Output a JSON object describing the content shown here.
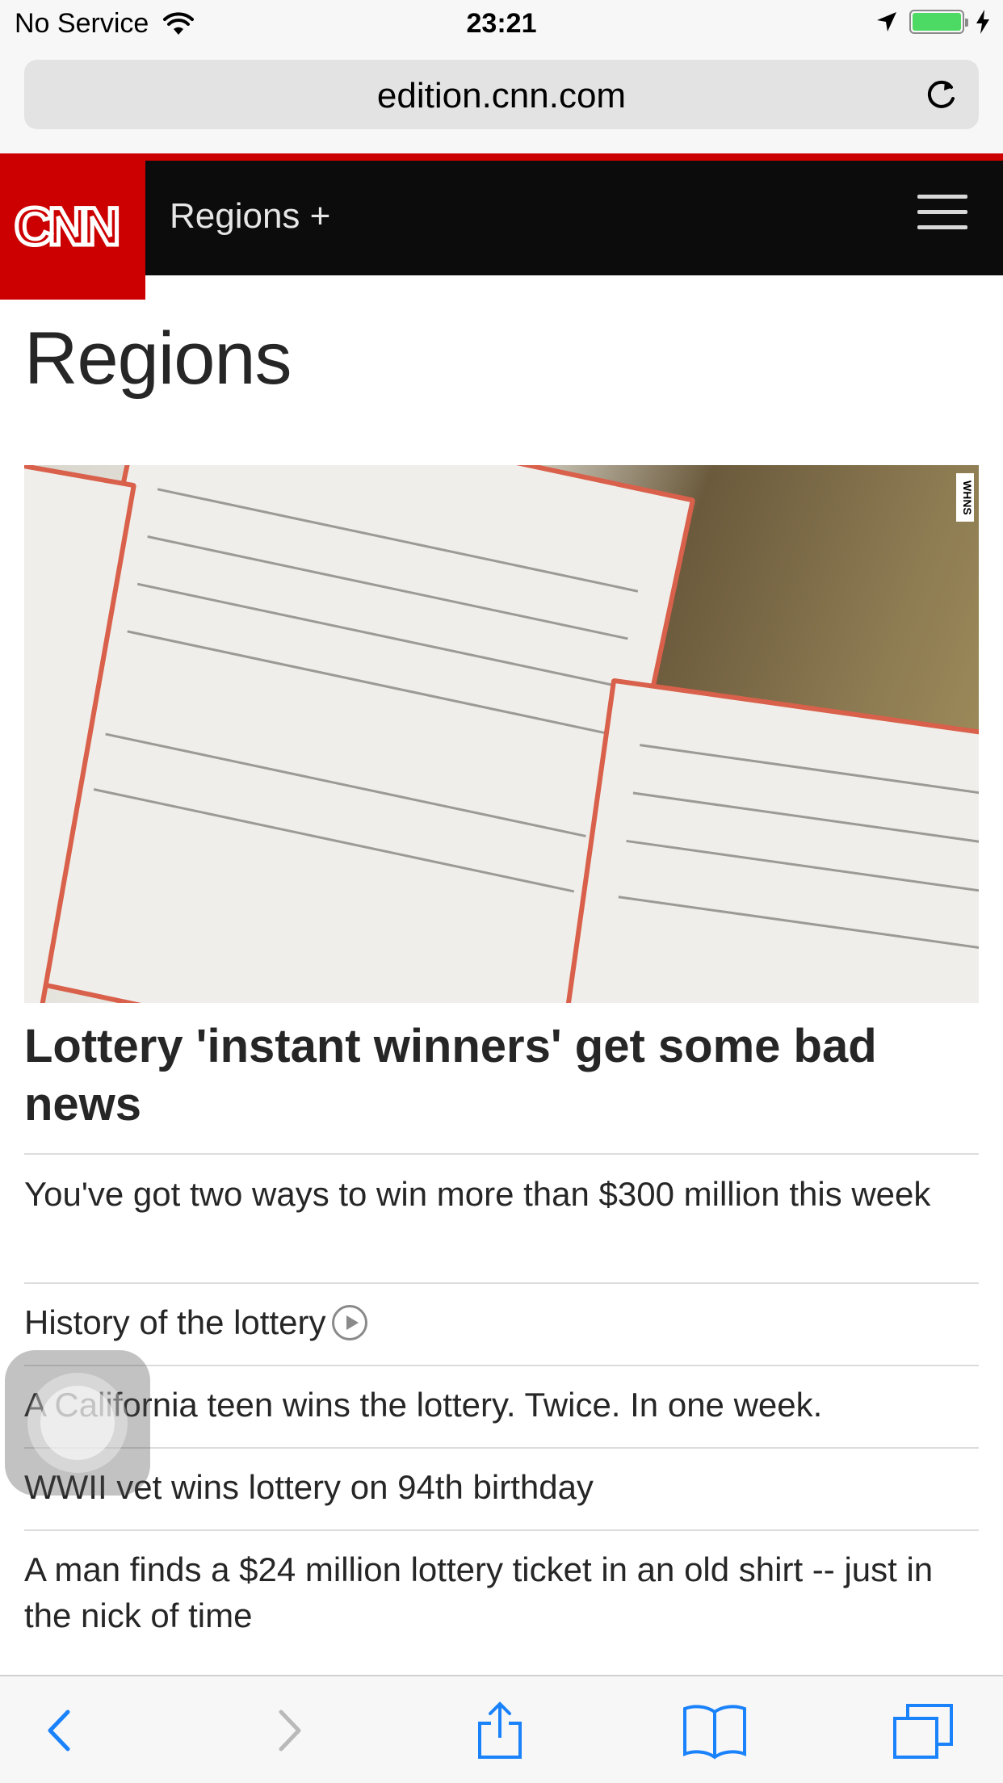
{
  "status": {
    "carrier": "No Service",
    "time": "23:21",
    "battery_level": 1.0,
    "icons": [
      "wifi-icon",
      "location-arrow-icon",
      "battery-icon",
      "charging-bolt-icon"
    ]
  },
  "browser": {
    "url": "edition.cnn.com",
    "toolbar_icons": [
      "back-icon",
      "forward-icon",
      "share-icon",
      "bookmarks-icon",
      "tabs-icon"
    ]
  },
  "header": {
    "logo_text": "CNN",
    "nav_title": "Regions +",
    "accent_color": "#cc0000"
  },
  "page": {
    "title": "Regions",
    "hero_credit": "WHNS",
    "headline": "Lottery 'instant winners' get some bad news",
    "links": [
      {
        "label": "You've got two ways to win more than $300 million this week",
        "video": false
      },
      {
        "label": "History of the lottery",
        "video": true
      },
      {
        "label": "A California teen wins the lottery. Twice. In one week.",
        "video": false
      },
      {
        "label": "WWII vet wins lottery on 94th birthday",
        "video": false
      },
      {
        "label": "A man finds a $24 million lottery ticket in an old shirt -- just in the nick of time",
        "video": false
      }
    ]
  },
  "colors": {
    "ios_blue": "#1a82fb",
    "disabled": "#b9b9b9"
  }
}
